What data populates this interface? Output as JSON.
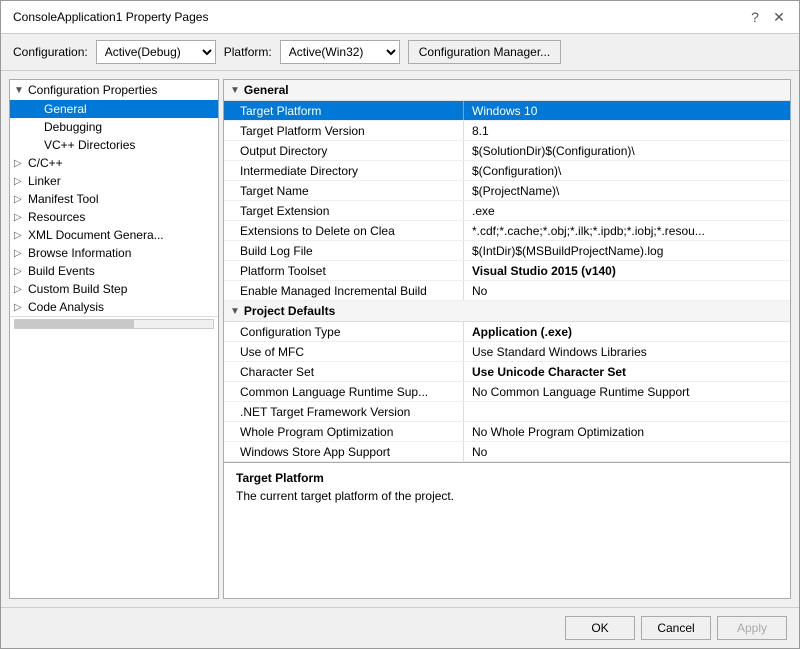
{
  "dialog": {
    "title": "ConsoleApplication1 Property Pages",
    "question_icon": "?",
    "close_icon": "✕"
  },
  "toolbar": {
    "configuration_label": "Configuration:",
    "configuration_value": "Active(Debug)",
    "platform_label": "Platform:",
    "platform_value": "Active(Win32)",
    "config_manager_label": "Configuration Manager..."
  },
  "left_panel": {
    "root_label": "Configuration Properties",
    "items": [
      {
        "id": "general",
        "label": "General",
        "indent": 1,
        "selected": true,
        "arrow": ""
      },
      {
        "id": "debugging",
        "label": "Debugging",
        "indent": 1,
        "selected": false,
        "arrow": ""
      },
      {
        "id": "vc-directories",
        "label": "VC++ Directories",
        "indent": 1,
        "selected": false,
        "arrow": ""
      },
      {
        "id": "cpp",
        "label": "C/C++",
        "indent": 0,
        "selected": false,
        "arrow": "▷"
      },
      {
        "id": "linker",
        "label": "Linker",
        "indent": 0,
        "selected": false,
        "arrow": "▷"
      },
      {
        "id": "manifest-tool",
        "label": "Manifest Tool",
        "indent": 0,
        "selected": false,
        "arrow": "▷"
      },
      {
        "id": "resources",
        "label": "Resources",
        "indent": 0,
        "selected": false,
        "arrow": "▷"
      },
      {
        "id": "xml-document",
        "label": "XML Document Genera...",
        "indent": 0,
        "selected": false,
        "arrow": "▷"
      },
      {
        "id": "browse-info",
        "label": "Browse Information",
        "indent": 0,
        "selected": false,
        "arrow": "▷"
      },
      {
        "id": "build-events",
        "label": "Build Events",
        "indent": 0,
        "selected": false,
        "arrow": "▷"
      },
      {
        "id": "custom-build",
        "label": "Custom Build Step",
        "indent": 0,
        "selected": false,
        "arrow": "▷"
      },
      {
        "id": "code-analysis",
        "label": "Code Analysis",
        "indent": 0,
        "selected": false,
        "arrow": "▷"
      }
    ]
  },
  "right_panel": {
    "sections": [
      {
        "id": "general",
        "label": "General",
        "expanded": true,
        "rows": [
          {
            "id": "target-platform",
            "name": "Target Platform",
            "value": "Windows 10",
            "selected": true,
            "bold": false
          },
          {
            "id": "target-platform-version",
            "name": "Target Platform Version",
            "value": "8.1",
            "selected": false,
            "bold": false
          },
          {
            "id": "output-directory",
            "name": "Output Directory",
            "value": "$(SolutionDir)$(Configuration)\\",
            "selected": false,
            "bold": false
          },
          {
            "id": "intermediate-directory",
            "name": "Intermediate Directory",
            "value": "$(Configuration)\\",
            "selected": false,
            "bold": false
          },
          {
            "id": "target-name",
            "name": "Target Name",
            "value": "$(ProjectName)\\",
            "selected": false,
            "bold": false
          },
          {
            "id": "target-extension",
            "name": "Target Extension",
            "value": ".exe",
            "selected": false,
            "bold": false
          },
          {
            "id": "extensions-delete",
            "name": "Extensions to Delete on Clea",
            "value": "*.cdf;*.cache;*.obj;*.ilk;*.ipdb;*.iobj;*.resou...",
            "selected": false,
            "bold": false
          },
          {
            "id": "build-log-file",
            "name": "Build Log File",
            "value": "$(IntDir)$(MSBuildProjectName).log",
            "selected": false,
            "bold": false
          },
          {
            "id": "platform-toolset",
            "name": "Platform Toolset",
            "value": "Visual Studio 2015 (v140)",
            "selected": false,
            "bold": true
          },
          {
            "id": "enable-managed",
            "name": "Enable Managed Incremental Build",
            "value": "No",
            "selected": false,
            "bold": false
          }
        ]
      },
      {
        "id": "project-defaults",
        "label": "Project Defaults",
        "expanded": true,
        "rows": [
          {
            "id": "config-type",
            "name": "Configuration Type",
            "value": "Application (.exe)",
            "selected": false,
            "bold": true
          },
          {
            "id": "use-mfc",
            "name": "Use of MFC",
            "value": "Use Standard Windows Libraries",
            "selected": false,
            "bold": false
          },
          {
            "id": "character-set",
            "name": "Character Set",
            "value": "Use Unicode Character Set",
            "selected": false,
            "bold": true
          },
          {
            "id": "clr-support",
            "name": "Common Language Runtime Sup...",
            "value": "No Common Language Runtime Support",
            "selected": false,
            "bold": false
          },
          {
            "id": "net-target",
            "name": ".NET Target Framework Version",
            "value": "",
            "selected": false,
            "bold": false,
            "gray": true
          },
          {
            "id": "whole-program",
            "name": "Whole Program Optimization",
            "value": "No Whole Program Optimization",
            "selected": false,
            "bold": false
          },
          {
            "id": "windows-store",
            "name": "Windows Store App Support",
            "value": "No",
            "selected": false,
            "bold": false
          }
        ]
      }
    ]
  },
  "description": {
    "title": "Target Platform",
    "text": "The current target platform of the project."
  },
  "buttons": {
    "ok": "OK",
    "cancel": "Cancel",
    "apply": "Apply"
  }
}
